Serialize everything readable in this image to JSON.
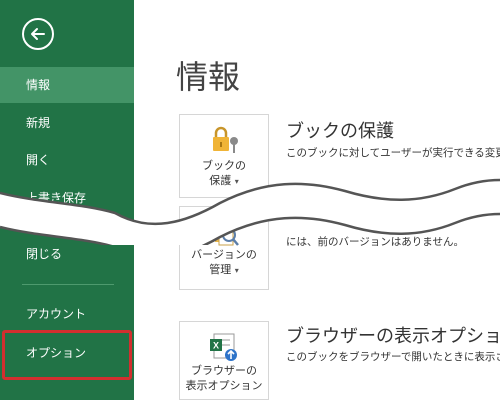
{
  "sidebar": {
    "items": [
      {
        "label": "情報",
        "active": true
      },
      {
        "label": "新規"
      },
      {
        "label": "開く"
      },
      {
        "label": "上書き保存"
      },
      {
        "label": "閉じる"
      },
      {
        "label": "アカウント"
      },
      {
        "label": "オプション"
      }
    ]
  },
  "main": {
    "title": "情報",
    "sections": [
      {
        "button_line1": "ブックの",
        "button_line2": "保護",
        "heading": "ブックの保護",
        "description": "このブックに対してユーザーが実行できる変更の"
      },
      {
        "button_line1": "バージョンの",
        "button_line2": "管理",
        "heading": "",
        "description": "には、前のバージョンはありません。"
      },
      {
        "button_line1": "ブラウザーの",
        "button_line2": "表示オプション",
        "heading": "ブラウザーの表示オプション",
        "description": "このブックをブラウザーで開いたときに表示さ"
      }
    ]
  },
  "colors": {
    "sidebar": "#217346",
    "sidebar_active": "#439467",
    "highlight": "#d32f2f"
  }
}
